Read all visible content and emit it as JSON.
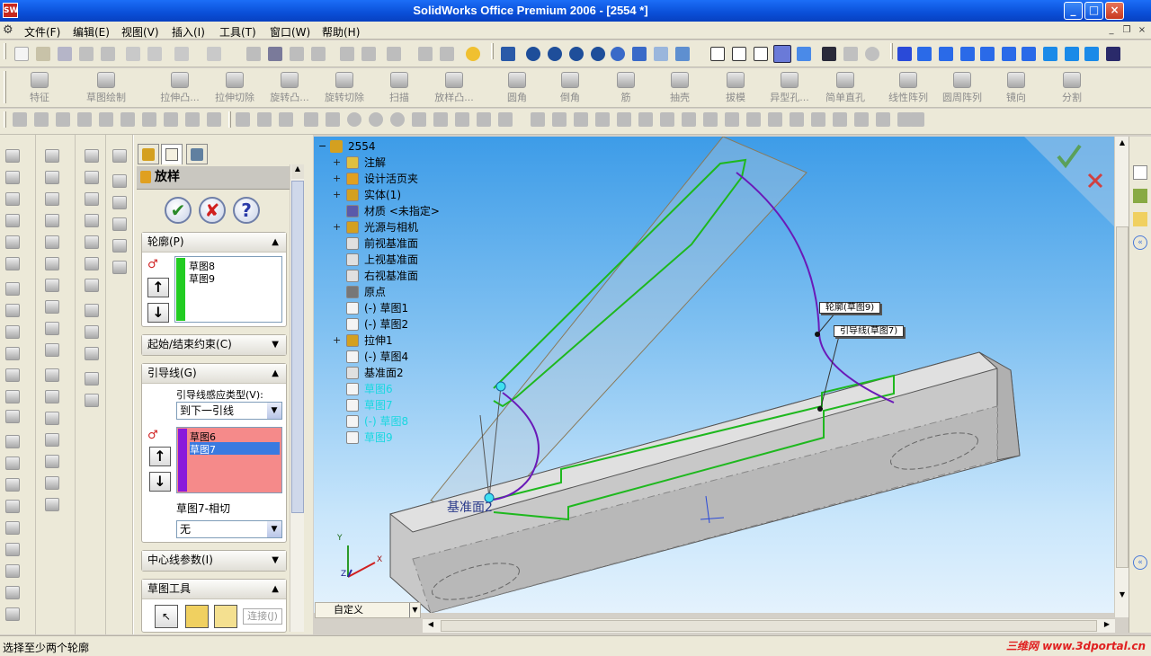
{
  "window": {
    "title": "SolidWorks Office Premium 2006 - [2554 *]",
    "app_icon_text": "SW"
  },
  "menu": {
    "items": [
      "文件(F)",
      "编辑(E)",
      "视图(V)",
      "插入(I)",
      "工具(T)",
      "窗口(W)",
      "帮助(H)"
    ]
  },
  "features_toolbar": {
    "items": [
      "特征",
      "草图绘制",
      "拉伸凸...",
      "拉伸切除",
      "旋转凸...",
      "旋转切除",
      "扫描",
      "放样凸...",
      "圆角",
      "倒角",
      "筋",
      "抽壳",
      "拔模",
      "异型孔...",
      "简单直孔",
      "线性阵列",
      "圆周阵列",
      "镜向",
      "分割"
    ]
  },
  "property_manager": {
    "title": "放样",
    "ok_label": "✔",
    "cancel_label": "✘",
    "help_label": "?",
    "profiles": {
      "header": "轮廓(P)",
      "items": [
        "草图8",
        "草图9"
      ],
      "accent": "#22cc22"
    },
    "start_end": {
      "header": "起始/结束约束(C)"
    },
    "guides": {
      "header": "引导线(G)",
      "type_label": "引导线感应类型(V):",
      "type_value": "到下一引线",
      "items": [
        "草图6",
        "草图7"
      ],
      "selected_index": 1,
      "accent": "#8a1adb",
      "tangency_label": "草图7-相切",
      "tangency_value": "无"
    },
    "centerline": {
      "header": "中心线参数(I)"
    },
    "sketch_tools": {
      "header": "草图工具",
      "connect_label": "连接(J)"
    }
  },
  "feature_tree": {
    "root": "2554",
    "items": [
      {
        "label": "注解",
        "expand": "+",
        "color": "#000000",
        "icon": "annotation-icon"
      },
      {
        "label": "设计活页夹",
        "expand": "+",
        "color": "#000000",
        "icon": "binder-icon"
      },
      {
        "label": "实体(1)",
        "expand": "+",
        "color": "#000000",
        "icon": "solid-bodies-icon"
      },
      {
        "label": "材质 <未指定>",
        "expand": "",
        "color": "#000000",
        "icon": "material-icon"
      },
      {
        "label": "光源与相机",
        "expand": "+",
        "color": "#000000",
        "icon": "lights-icon"
      },
      {
        "label": "前视基准面",
        "expand": "",
        "color": "#000000",
        "icon": "plane-icon"
      },
      {
        "label": "上视基准面",
        "expand": "",
        "color": "#000000",
        "icon": "plane-icon"
      },
      {
        "label": "右视基准面",
        "expand": "",
        "color": "#000000",
        "icon": "plane-icon"
      },
      {
        "label": "原点",
        "expand": "",
        "color": "#000000",
        "icon": "origin-icon"
      },
      {
        "label": "(-) 草图1",
        "expand": "",
        "color": "#000000",
        "icon": "sketch-icon"
      },
      {
        "label": "(-) 草图2",
        "expand": "",
        "color": "#000000",
        "icon": "sketch-icon"
      },
      {
        "label": "拉伸1",
        "expand": "+",
        "color": "#000000",
        "icon": "extrude-icon"
      },
      {
        "label": "(-) 草图4",
        "expand": "",
        "color": "#000000",
        "icon": "sketch-icon"
      },
      {
        "label": "基准面2",
        "expand": "",
        "color": "#000000",
        "icon": "plane-icon"
      },
      {
        "label": "草图6",
        "expand": "",
        "color": "#19d7e0",
        "icon": "sketch-icon"
      },
      {
        "label": "草图7",
        "expand": "",
        "color": "#19d7e0",
        "icon": "sketch-icon"
      },
      {
        "label": "(-) 草图8",
        "expand": "",
        "color": "#19d7e0",
        "icon": "sketch-icon"
      },
      {
        "label": "草图9",
        "expand": "",
        "color": "#19d7e0",
        "icon": "sketch-icon"
      }
    ]
  },
  "viewport": {
    "callout_profile": "轮廓(草图9)",
    "callout_guide": "引导线(草图7)",
    "plane_label": "基准面2",
    "axis_x": "X",
    "axis_y": "Y",
    "axis_z": "Z"
  },
  "bottom": {
    "custom_label": "自定义"
  },
  "status": {
    "text": "选择至少两个轮廓",
    "watermark": "三维网 www.3dportal.cn"
  }
}
